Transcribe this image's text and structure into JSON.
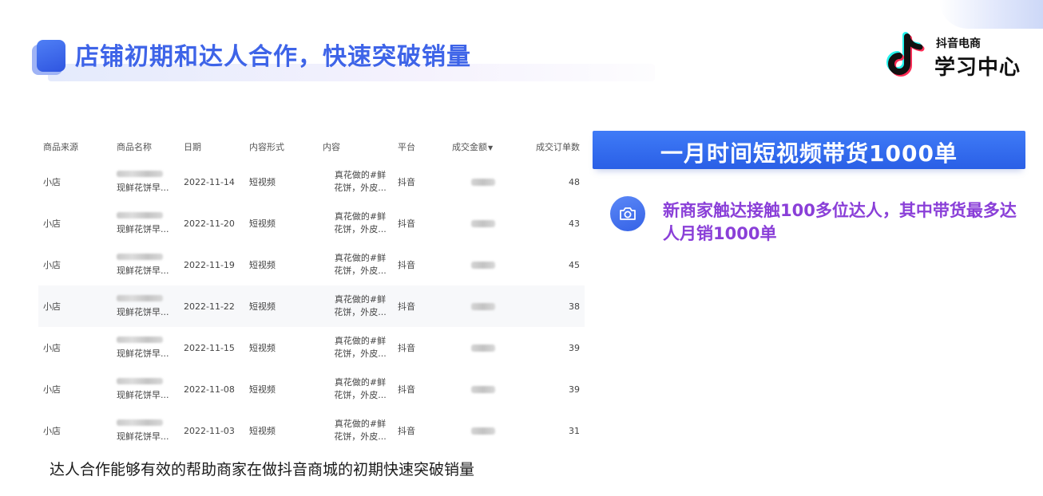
{
  "header": {
    "title": "店铺初期和达人合作，快速突破销量"
  },
  "logo": {
    "small_text": "抖音电商",
    "big_text": "学习中心"
  },
  "table": {
    "columns": [
      "商品来源",
      "商品名称",
      "日期",
      "内容形式",
      "内容",
      "平台",
      "成交金额",
      "成交订单数"
    ],
    "sort_indicator": "▼",
    "rows": [
      {
        "source": "小店",
        "name": "现鲜花饼早...",
        "date": "2022-11-14",
        "format": "短视频",
        "content_l1": "真花做的#鲜",
        "content_l2": "花饼，外皮...",
        "platform": "抖音",
        "orders": "48"
      },
      {
        "source": "小店",
        "name": "现鲜花饼早...",
        "date": "2022-11-20",
        "format": "短视频",
        "content_l1": "真花做的#鲜",
        "content_l2": "花饼，外皮...",
        "platform": "抖音",
        "orders": "43"
      },
      {
        "source": "小店",
        "name": "现鲜花饼早...",
        "date": "2022-11-19",
        "format": "短视频",
        "content_l1": "真花做的#鲜",
        "content_l2": "花饼，外皮...",
        "platform": "抖音",
        "orders": "45"
      },
      {
        "source": "小店",
        "name": "现鲜花饼早...",
        "date": "2022-11-22",
        "format": "短视频",
        "content_l1": "真花做的#鲜",
        "content_l2": "花饼，外皮...",
        "platform": "抖音",
        "orders": "38"
      },
      {
        "source": "小店",
        "name": "现鲜花饼早...",
        "date": "2022-11-15",
        "format": "短视频",
        "content_l1": "真花做的#鲜",
        "content_l2": "花饼，外皮...",
        "platform": "抖音",
        "orders": "39"
      },
      {
        "source": "小店",
        "name": "现鲜花饼早...",
        "date": "2022-11-08",
        "format": "短视频",
        "content_l1": "真花做的#鲜",
        "content_l2": "花饼，外皮...",
        "platform": "抖音",
        "orders": "39"
      },
      {
        "source": "小店",
        "name": "现鲜花饼早...",
        "date": "2022-11-03",
        "format": "短视频",
        "content_l1": "真花做的#鲜",
        "content_l2": "花饼，外皮...",
        "platform": "抖音",
        "orders": "31"
      }
    ]
  },
  "caption": "达人合作能够有效的帮助商家在做抖音商城的初期快速突破销量",
  "banner": {
    "text": "一月时间短视频带货1000单"
  },
  "note": {
    "icon": "camera-icon",
    "text": "新商家触达接触100多位达人，其中带货最多达人月销1000单"
  },
  "colors": {
    "title_blue": "#3e64e8",
    "banner_blue": "#2f66ec",
    "note_purple": "#8a3fd8"
  }
}
